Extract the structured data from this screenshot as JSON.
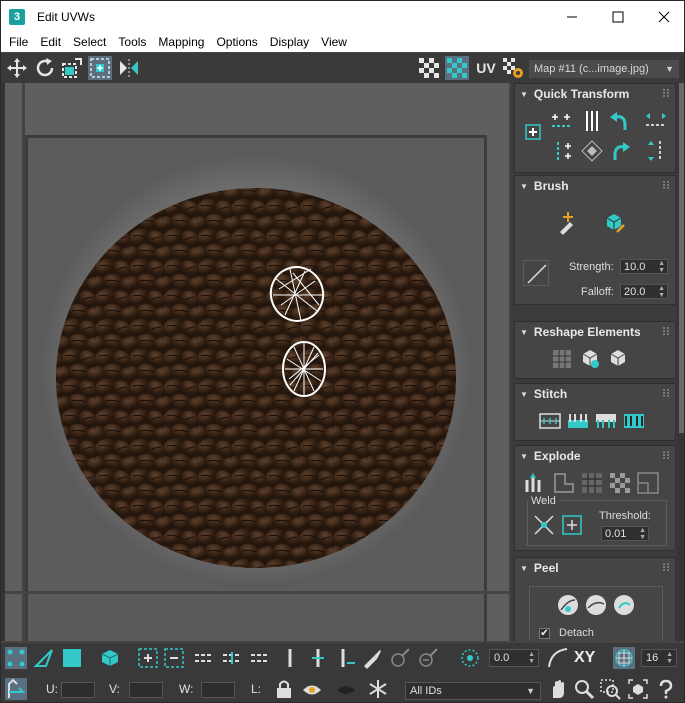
{
  "window": {
    "app_icon": "3",
    "title": "Edit UVWs",
    "controls": [
      "minimize-icon",
      "maximize-icon",
      "close-icon"
    ]
  },
  "menu": [
    "File",
    "Edit",
    "Select",
    "Tools",
    "Mapping",
    "Options",
    "Display",
    "View"
  ],
  "top_toolbar": {
    "uv_label": "UV",
    "texture_dropdown": "Map #11 (c...image.jpg)",
    "tools": [
      "move-icon",
      "rotate-icon",
      "scale-icon",
      "freeform-icon",
      "mirror-icon",
      "checker-icon",
      "checker-icon",
      "show-map-icon",
      "texture-settings-icon"
    ]
  },
  "panels": {
    "quick_transform": {
      "title": "Quick Transform"
    },
    "brush": {
      "title": "Brush",
      "strength_label": "Strength:",
      "strength_value": "10.0",
      "falloff_label": "Falloff:",
      "falloff_value": "20.0"
    },
    "reshape": {
      "title": "Reshape Elements"
    },
    "stitch": {
      "title": "Stitch"
    },
    "explode": {
      "title": "Explode",
      "weld_label": "Weld",
      "threshold_label": "Threshold:",
      "threshold_value": "0.01"
    },
    "peel": {
      "title": "Peel",
      "detach_label": "Detach",
      "detach_checked": true
    }
  },
  "bottom_toolbar": {
    "angle_value": "0.0",
    "xy_label": "XY",
    "count_value": "16",
    "u_label": "U:",
    "v_label": "V:",
    "w_label": "W:",
    "l_label": "L:",
    "ids_dropdown": "All IDs"
  },
  "colors": {
    "accent": "#33c9c9",
    "panel_bg": "#454545",
    "toolbar_bg": "#3a3a3a"
  }
}
